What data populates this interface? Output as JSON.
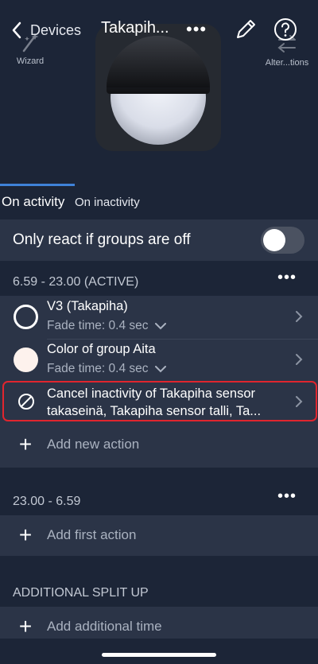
{
  "nav": {
    "back_label": "Devices",
    "title": "Takapih...",
    "more": "•••",
    "wizard_label": "Wizard",
    "alter_label": "Alter...tions"
  },
  "tabs": [
    {
      "label": "On activity",
      "active": true
    },
    {
      "label": "On inactivity",
      "active": false
    }
  ],
  "toggle": {
    "label": "Only react if groups are off",
    "on": false
  },
  "sections": [
    {
      "header": "6.59 - 23.00 (ACTIVE)",
      "actions": [
        {
          "title": "V3 (Takapiha)",
          "subtitle": "Fade time: 0.4 sec",
          "icon": "empty-circle-icon"
        },
        {
          "title": "Color of group Aita",
          "subtitle": "Fade time: 0.4 sec",
          "icon": "filled-circle-icon"
        },
        {
          "title": "Cancel inactivity of Takapiha sensor",
          "title2": "takaseinä, Takapiha sensor talli, Ta...",
          "icon": "cancel-icon"
        }
      ],
      "add_label": "Add new action"
    },
    {
      "header": "23.00 - 6.59",
      "add_label": "Add first action"
    }
  ],
  "additional": {
    "header": "ADDITIONAL SPLIT UP",
    "add_label": "Add additional time"
  },
  "more_glyph": "•••",
  "colors": {
    "background": "#1c2537",
    "card": "#2b3447",
    "accent": "#3f82d8",
    "highlight": "#e0252e"
  }
}
